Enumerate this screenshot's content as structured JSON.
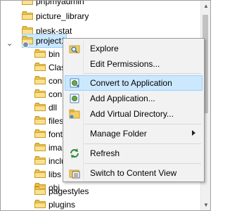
{
  "tree": {
    "items": [
      {
        "label": "phpmyadmin"
      },
      {
        "label": "picture_library"
      },
      {
        "label": "plesk-stat"
      },
      {
        "label": "project1"
      },
      {
        "label": "bin"
      },
      {
        "label": "Clas"
      },
      {
        "label": "con"
      },
      {
        "label": "con"
      },
      {
        "label": "dll"
      },
      {
        "label": "files"
      },
      {
        "label": "font"
      },
      {
        "label": "ima"
      },
      {
        "label": "inclu"
      },
      {
        "label": "libs"
      },
      {
        "label": "obj"
      },
      {
        "label": "pagestyles"
      },
      {
        "label": "plugins"
      }
    ]
  },
  "context_menu": {
    "items": [
      {
        "label": "Explore",
        "icon": "explore-icon"
      },
      {
        "label": "Edit Permissions..."
      },
      {
        "label": "Convert to Application",
        "icon": "convert-app-icon",
        "highlighted": true
      },
      {
        "label": "Add Application...",
        "icon": "add-app-icon"
      },
      {
        "label": "Add Virtual Directory...",
        "icon": "add-vdir-icon"
      },
      {
        "label": "Manage Folder",
        "submenu": true
      },
      {
        "label": "Refresh",
        "icon": "refresh-icon"
      },
      {
        "label": "Switch to Content View",
        "icon": "content-view-icon"
      }
    ]
  },
  "colors": {
    "selection": "#cce8ff",
    "selection_border": "#99d1ff",
    "menu_bg": "#f2f2f2",
    "folder": "#f4ce62"
  }
}
